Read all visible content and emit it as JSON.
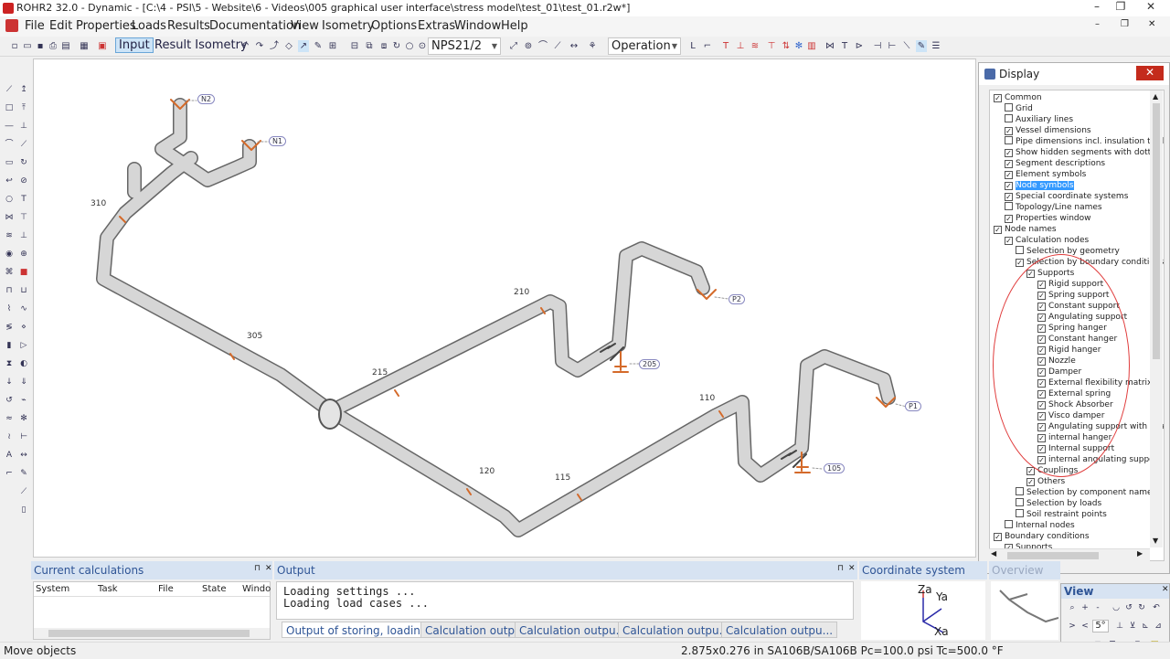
{
  "window": {
    "title": "ROHR2 32.0 - Dynamic - [C:\\4 - PSI\\5 - Website\\6 - Videos\\005 graphical user interface\\stress model\\test_01\\test_01.r2w*]"
  },
  "menu": [
    "File",
    "Edit",
    "Properties",
    "Loads",
    "Results",
    "Documentation",
    "View",
    "Isometry",
    "Options",
    "Extras",
    "Window",
    "Help"
  ],
  "toolbar": {
    "input": "Input",
    "result_isometry": "Result  Isometry",
    "pipe_class": "NPS21/2",
    "load_case": "Operation"
  },
  "canvas": {
    "node_labels": [
      "310",
      "305",
      "215",
      "210",
      "110",
      "115",
      "120"
    ],
    "node_bubbles": [
      "N2",
      "N1",
      "P2",
      "205",
      "P1",
      "105"
    ]
  },
  "display": {
    "title": "Display",
    "close": "✕",
    "items": [
      {
        "label": "Common",
        "checked": true,
        "level": 0
      },
      {
        "label": "Grid",
        "checked": false,
        "level": 1
      },
      {
        "label": "Auxiliary lines",
        "checked": false,
        "level": 1
      },
      {
        "label": "Vessel dimensions",
        "checked": true,
        "level": 1
      },
      {
        "label": "Pipe dimensions incl. insulation thickne",
        "checked": false,
        "level": 1
      },
      {
        "label": "Show hidden segments with dotted lin",
        "checked": true,
        "level": 1
      },
      {
        "label": "Segment descriptions",
        "checked": true,
        "level": 1
      },
      {
        "label": "Element symbols",
        "checked": true,
        "level": 1
      },
      {
        "label": "Node symbols",
        "checked": true,
        "level": 1,
        "selected": true
      },
      {
        "label": "Special coordinate systems",
        "checked": true,
        "level": 1
      },
      {
        "label": "Topology/Line names",
        "checked": false,
        "level": 1
      },
      {
        "label": "Properties window",
        "checked": true,
        "level": 1
      },
      {
        "label": "Node names",
        "checked": true,
        "level": 0
      },
      {
        "label": "Calculation nodes",
        "checked": true,
        "level": 1
      },
      {
        "label": "Selection by geometry",
        "checked": false,
        "level": 2
      },
      {
        "label": "Selection by boundary conditions",
        "checked": true,
        "level": 2
      },
      {
        "label": "Supports",
        "checked": true,
        "level": 3
      },
      {
        "label": "Rigid support",
        "checked": true,
        "level": 4
      },
      {
        "label": "Spring support",
        "checked": true,
        "level": 4
      },
      {
        "label": "Constant support",
        "checked": true,
        "level": 4
      },
      {
        "label": "Angulating support",
        "checked": true,
        "level": 4
      },
      {
        "label": "Spring hanger",
        "checked": true,
        "level": 4
      },
      {
        "label": "Constant hanger",
        "checked": true,
        "level": 4
      },
      {
        "label": "Rigid hanger",
        "checked": true,
        "level": 4
      },
      {
        "label": "Nozzle",
        "checked": true,
        "level": 4
      },
      {
        "label": "Damper",
        "checked": true,
        "level": 4
      },
      {
        "label": "External flexibility matrix",
        "checked": true,
        "level": 4
      },
      {
        "label": "External spring",
        "checked": true,
        "level": 4
      },
      {
        "label": "Shock Absorber",
        "checked": true,
        "level": 4
      },
      {
        "label": "Visco damper",
        "checked": true,
        "level": 4
      },
      {
        "label": "Angulating support with cha",
        "checked": true,
        "level": 4
      },
      {
        "label": "internal hanger",
        "checked": true,
        "level": 4
      },
      {
        "label": "Internal support",
        "checked": true,
        "level": 4
      },
      {
        "label": "internal angulating support",
        "checked": true,
        "level": 4
      },
      {
        "label": "Couplings",
        "checked": true,
        "level": 3
      },
      {
        "label": "Others",
        "checked": true,
        "level": 3
      },
      {
        "label": "Selection by component name",
        "checked": false,
        "level": 2
      },
      {
        "label": "Selection by loads",
        "checked": false,
        "level": 2
      },
      {
        "label": "Soil restraint points",
        "checked": false,
        "level": 2
      },
      {
        "label": "Internal nodes",
        "checked": false,
        "level": 1
      },
      {
        "label": "Boundary conditions",
        "checked": true,
        "level": 0
      },
      {
        "label": "Supports",
        "checked": true,
        "level": 1
      }
    ]
  },
  "current_calc": {
    "title": "Current calculations",
    "columns": [
      "System",
      "Task",
      "File",
      "State",
      "Windo"
    ]
  },
  "output": {
    "title": "Output",
    "lines": [
      "Loading settings ...",
      "Loading load cases ..."
    ],
    "tabs": [
      "Output of storing, loading...",
      "Calculation outp...",
      "Calculation outpu...",
      "Calculation outpu...",
      "Calculation outpu..."
    ]
  },
  "coord": {
    "title": "Coordinate system",
    "za": "Za",
    "ya": "Ya",
    "xa": "Xa"
  },
  "overview": {
    "title": "Overview"
  },
  "view": {
    "title": "View",
    "zoom": "5°"
  },
  "status": {
    "left": "Move objects",
    "right": "2.875x0.276 in SA106B/SA106B Pc=100.0 psi Tc=500.0 °F"
  }
}
